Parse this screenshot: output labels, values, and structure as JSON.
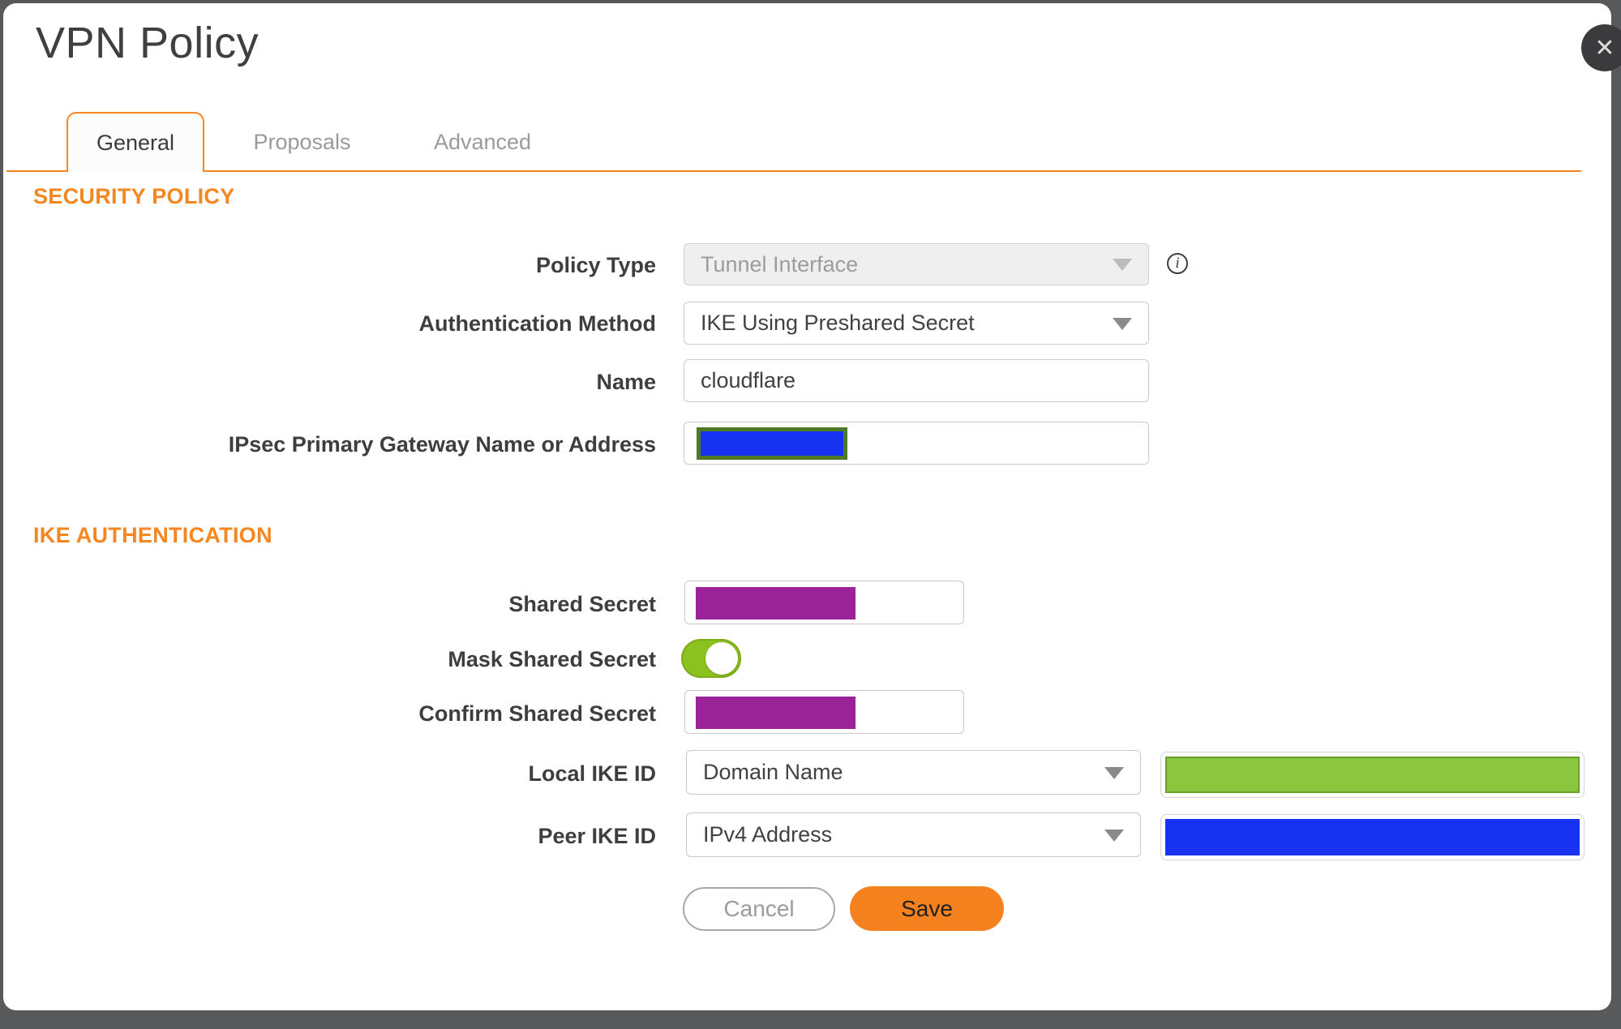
{
  "dialog": {
    "title": "VPN Policy",
    "close_icon": "✕"
  },
  "tabs": [
    {
      "label": "General",
      "active": true
    },
    {
      "label": "Proposals",
      "active": false
    },
    {
      "label": "Advanced",
      "active": false
    }
  ],
  "sections": {
    "security_policy": "SECURITY POLICY",
    "ike_authentication": "IKE AUTHENTICATION"
  },
  "fields": {
    "policy_type": {
      "label": "Policy Type",
      "value": "Tunnel Interface",
      "disabled": true,
      "info_icon": "info-icon"
    },
    "authentication_method": {
      "label": "Authentication Method",
      "value": "IKE Using Preshared Secret"
    },
    "name": {
      "label": "Name",
      "value": "cloudflare"
    },
    "ipsec_primary_gateway": {
      "label": "IPsec Primary Gateway Name or Address",
      "value": "",
      "redaction": "blue-box-green-border"
    },
    "shared_secret": {
      "label": "Shared Secret",
      "value": "",
      "redaction": "purple-box"
    },
    "mask_shared_secret": {
      "label": "Mask Shared Secret",
      "toggle_state": "on"
    },
    "confirm_shared_secret": {
      "label": "Confirm Shared Secret",
      "value": "",
      "redaction": "purple-box"
    },
    "local_ike_id": {
      "label": "Local IKE ID",
      "type_selected": "Domain Name",
      "value": "",
      "redaction": "green-box"
    },
    "peer_ike_id": {
      "label": "Peer IKE ID",
      "type_selected": "IPv4 Address",
      "value": "",
      "redaction": "blue-box"
    }
  },
  "buttons": {
    "cancel": "Cancel",
    "save": "Save"
  },
  "icons": {
    "info": "i",
    "close": "✕"
  },
  "colors": {
    "accent_orange": "#F6861F",
    "save_orange": "#F5821F",
    "redact_purple": "#9A2397",
    "redact_blue": "#1733F1",
    "redact_green_fill": "#8CC63F",
    "redact_green_border": "#69A12F",
    "gateway_border_green": "#4E7A28",
    "toggle_green": "#8CC220",
    "page_background": "#58595B",
    "close_button": "#3B3B3D"
  }
}
